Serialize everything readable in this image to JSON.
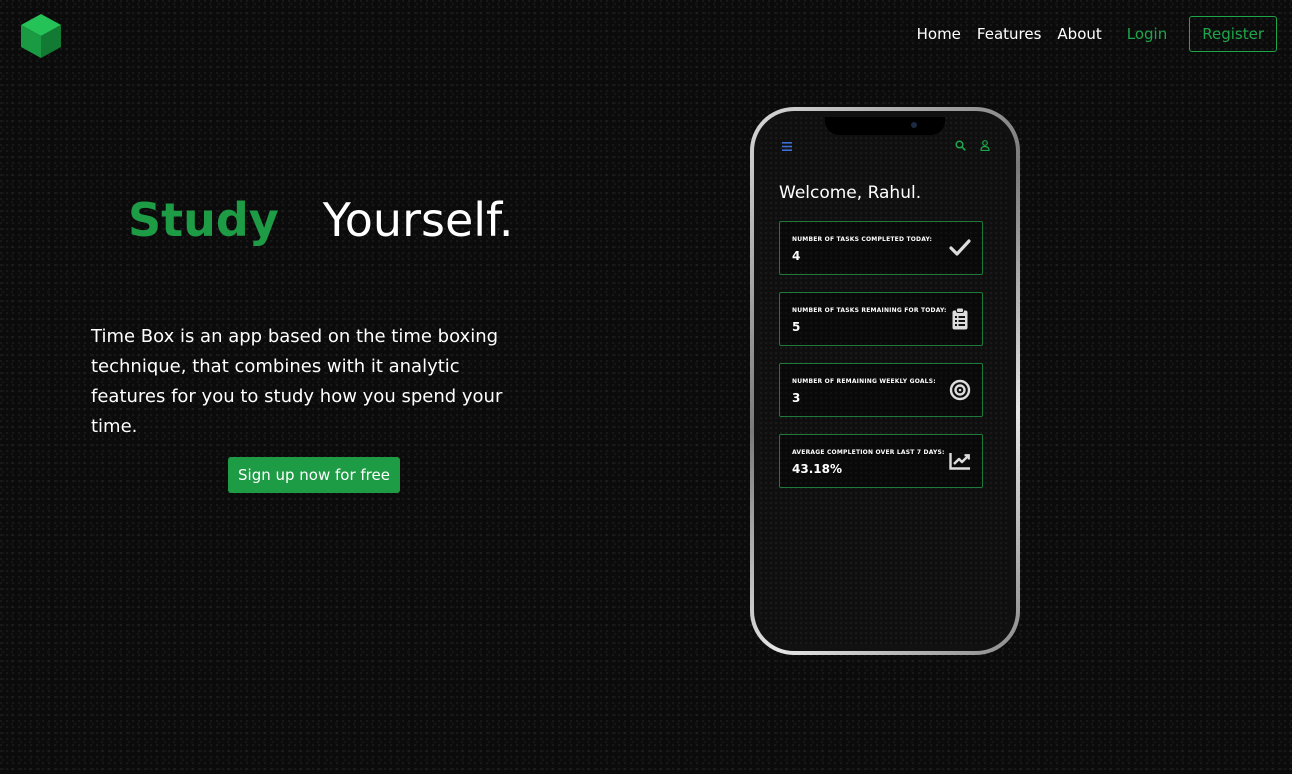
{
  "nav": {
    "links": [
      "Home",
      "Features",
      "About"
    ],
    "login": "Login",
    "register": "Register"
  },
  "hero": {
    "title_green": "Study",
    "title_white": "Yourself.",
    "description": "Time Box is an app based on the time boxing technique, that combines with it analytic features for you to study how you spend your time.",
    "cta": "Sign up now for free"
  },
  "phone": {
    "welcome": "Welcome, Rahul.",
    "cards": [
      {
        "label": "NUMBER OF TASKS COMPLETED TODAY:",
        "value": "4",
        "icon": "check-icon"
      },
      {
        "label": "NUMBER OF TASKS REMAINING FOR TODAY:",
        "value": "5",
        "icon": "clipboard-icon"
      },
      {
        "label": "NUMBER OF REMAINING WEEKLY GOALS:",
        "value": "3",
        "icon": "target-icon"
      },
      {
        "label": "AVERAGE COMPLETION OVER LAST 7 DAYS:",
        "value": "43.18%",
        "icon": "chart-line-icon"
      }
    ]
  },
  "colors": {
    "brand_green": "#1e9b45",
    "background": "#0b0b0b"
  }
}
